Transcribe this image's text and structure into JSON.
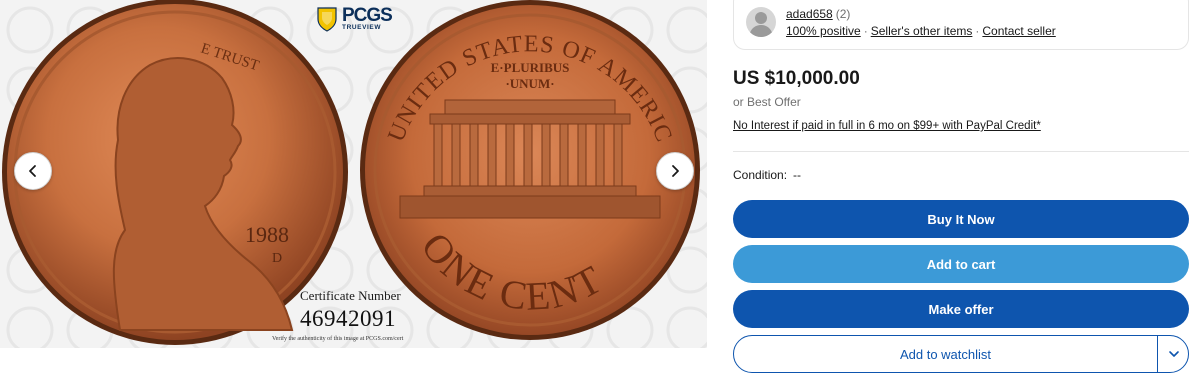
{
  "gallery": {
    "prev_icon": "chevron-left-icon",
    "next_icon": "chevron-right-icon",
    "logo": {
      "brand": "PCGS",
      "sub": "TRUEVIEW"
    },
    "coin_obverse": {
      "motto": "E TRUST",
      "year": "1988",
      "mint": "D"
    },
    "coin_reverse": {
      "top": "UNITED STATES OF AMERICA",
      "motto_line1": "E·PLURIBUS",
      "motto_line2": "·UNUM·",
      "denomination": "ONE CENT"
    },
    "certificate_label": "Certificate Number",
    "certificate_number": "46942091",
    "verify_text": "Verify the authenticity of this image at PCGS.com/cert",
    "colors": {
      "copper": "#c46a3a",
      "background": "#f3f3f3"
    }
  },
  "seller": {
    "avatar_icon": "user-avatar-icon",
    "name": "adad658",
    "count": "(2)",
    "feedback": "100% positive",
    "other_items": "Seller's other items",
    "contact": "Contact seller"
  },
  "listing": {
    "price": "US $10,000.00",
    "best_offer": "or Best Offer",
    "credit": "No Interest if paid in full in 6 mo on $99+ with PayPal Credit*",
    "condition_label": "Condition:",
    "condition_value": "--"
  },
  "actions": {
    "buy_now": "Buy It Now",
    "add_to_cart": "Add to cart",
    "make_offer": "Make offer",
    "add_to_watchlist": "Add to watchlist",
    "watchlist_dropdown_icon": "chevron-down-icon"
  },
  "colors": {
    "primary": "#0e55ae",
    "secondary": "#3c9ad7"
  }
}
